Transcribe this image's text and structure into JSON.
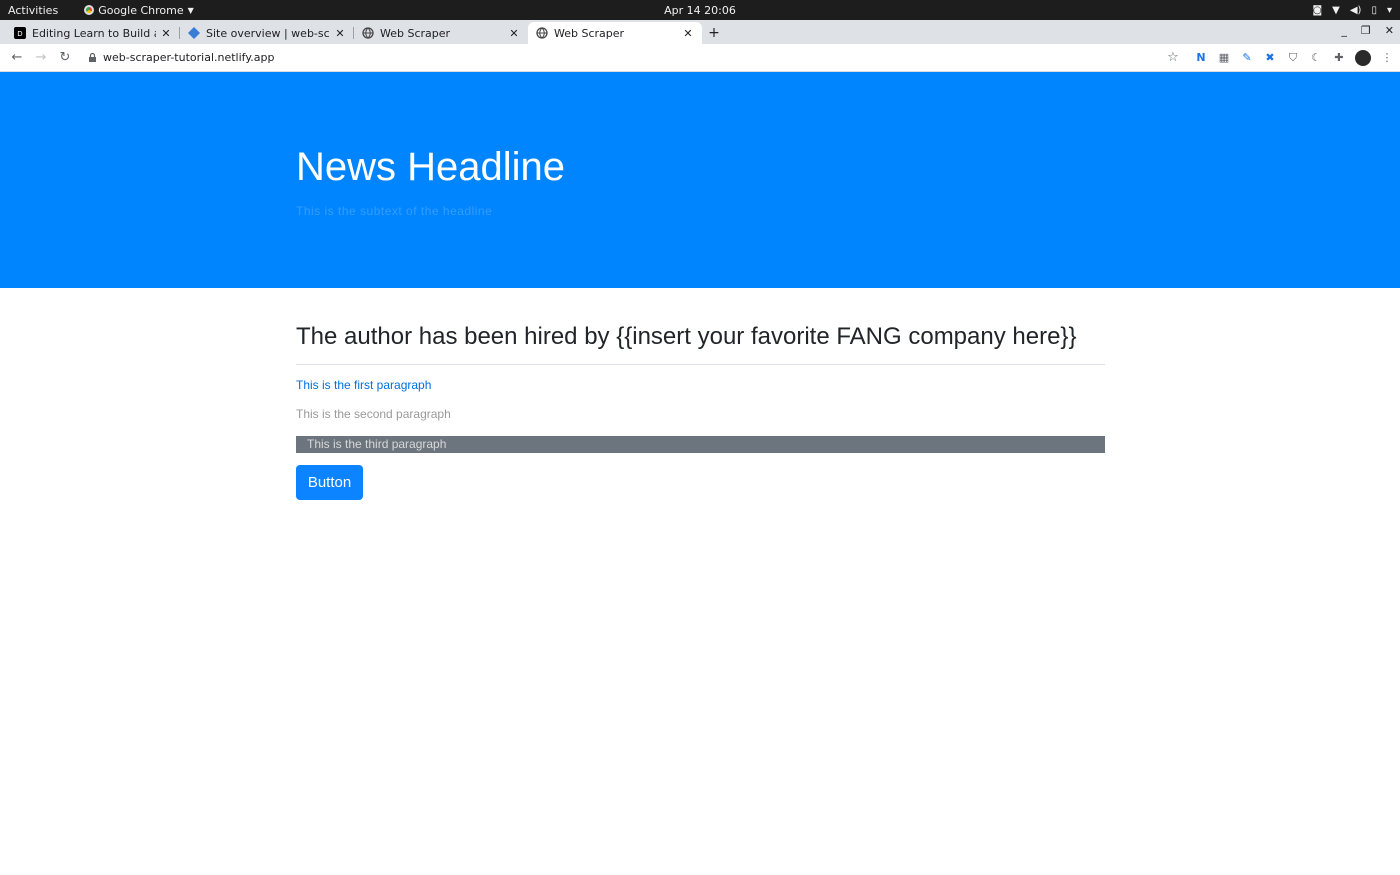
{
  "system_bar": {
    "activities": "Activities",
    "app_name": "Google Chrome",
    "clock": "Apr 14  20:06"
  },
  "tabs": [
    {
      "title": "Editing Learn to Build a W",
      "icon": "dev-to-icon",
      "active": false
    },
    {
      "title": "Site overview | web-scrap",
      "icon": "netlify-icon",
      "active": false
    },
    {
      "title": "Web Scraper",
      "icon": "globe-icon",
      "active": false
    },
    {
      "title": "Web Scraper",
      "icon": "globe-icon",
      "active": true
    }
  ],
  "address_bar": {
    "url": "web-scraper-tutorial.netlify.app"
  },
  "page": {
    "headline": "News Headline",
    "headline_sub": "This is the subtext of the headline",
    "article_title": "The author has been hired by {{insert your favorite FANG company here}}",
    "paragraphs": [
      "This is the first paragraph",
      "This is the second paragraph",
      "This is the third paragraph"
    ],
    "button_label": "Button"
  },
  "colors": {
    "jumbotron_bg": "#0085ff",
    "button_bg": "#0d84ff",
    "link_text": "#0070e0",
    "third_paragraph_bg": "#6c757d"
  }
}
